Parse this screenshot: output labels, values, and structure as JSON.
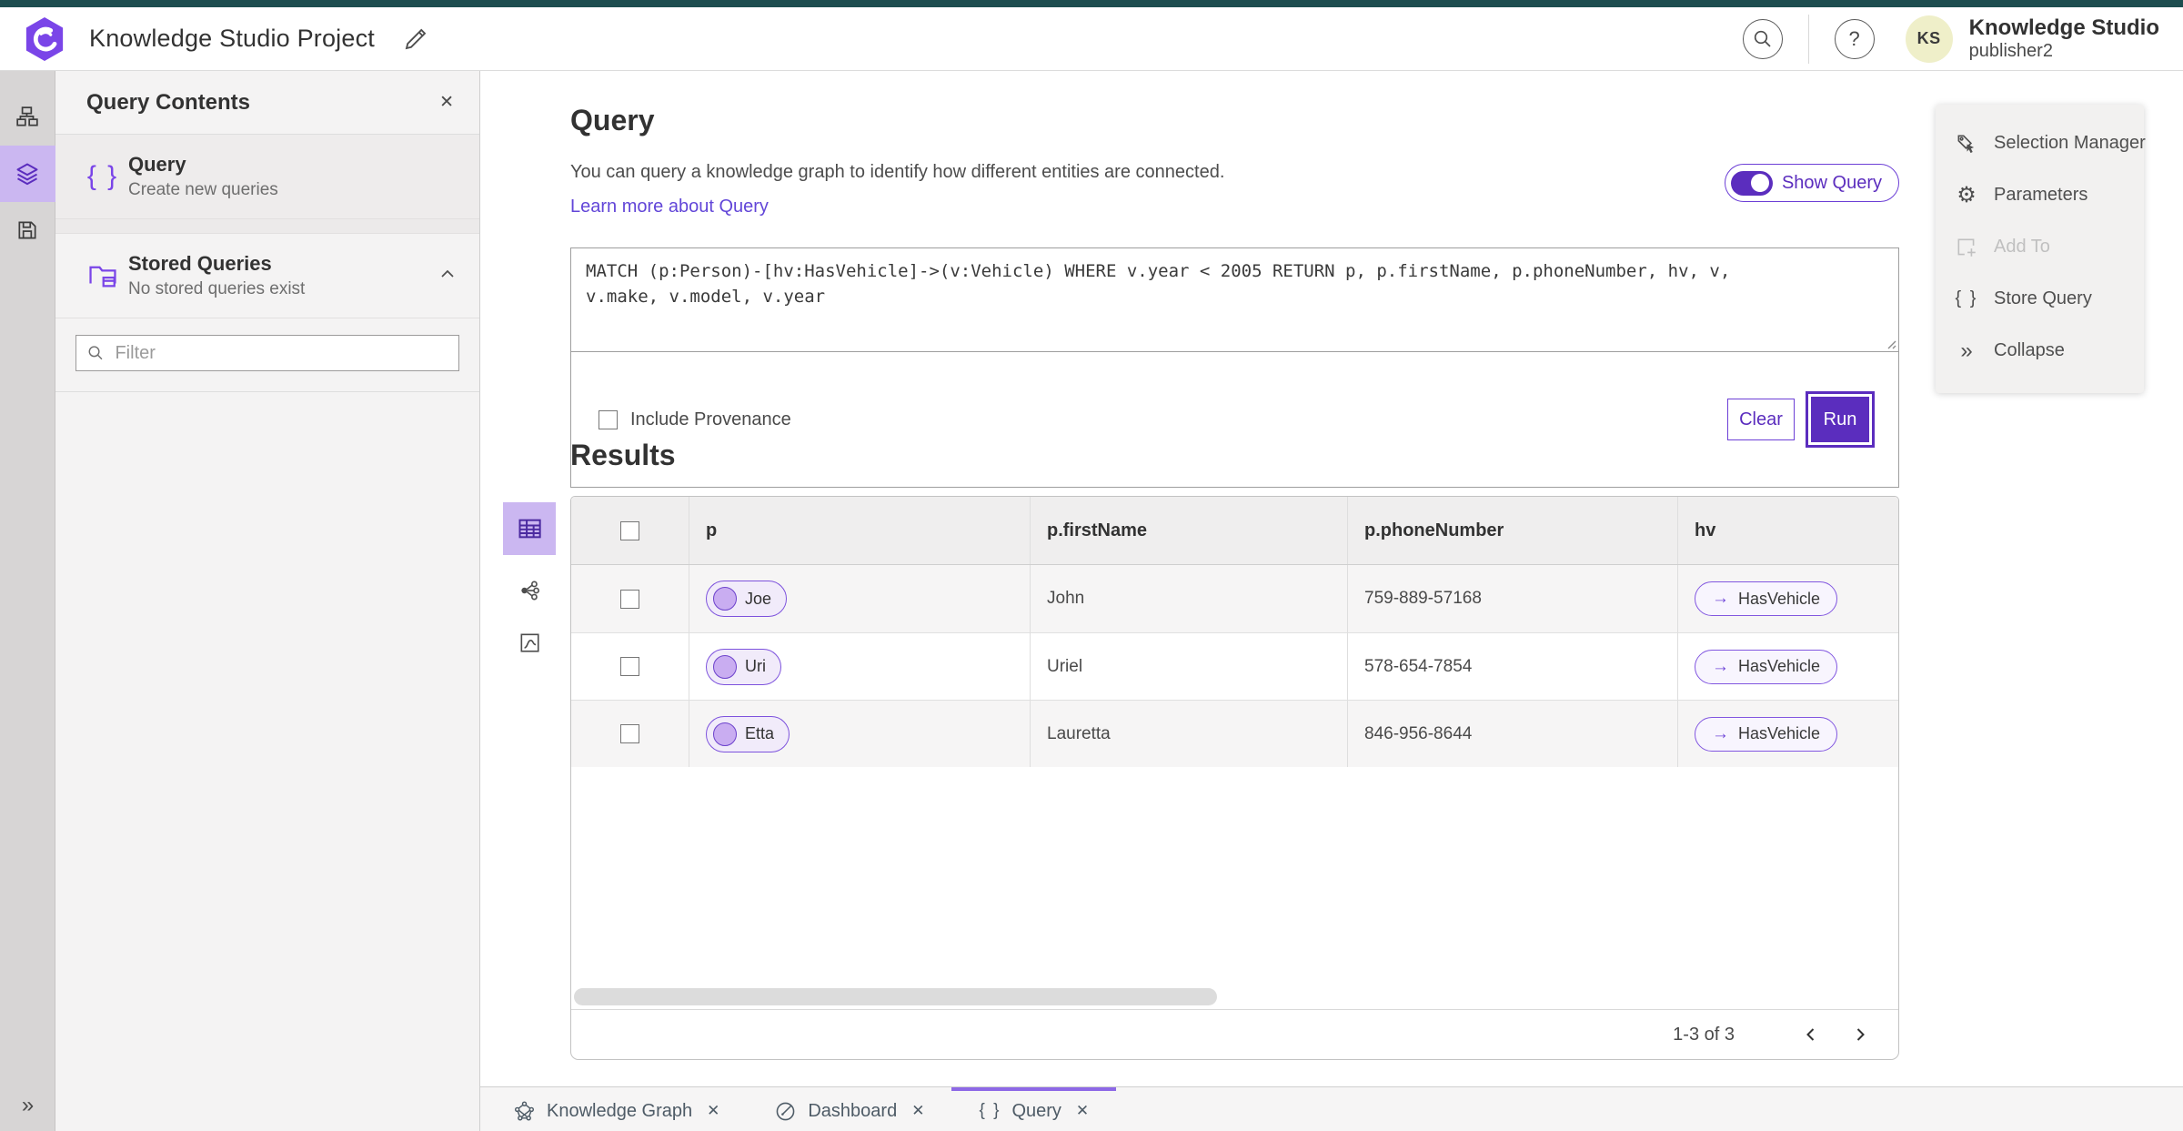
{
  "header": {
    "title": "Knowledge Studio Project",
    "account_title": "Knowledge Studio",
    "account_subtitle": "publisher2",
    "avatar_initials": "KS"
  },
  "panel": {
    "title": "Query Contents",
    "query_item": {
      "title": "Query",
      "subtitle": "Create new queries"
    },
    "stored_item": {
      "title": "Stored Queries",
      "subtitle": "No stored queries exist"
    },
    "filter_placeholder": "Filter"
  },
  "query_section": {
    "heading": "Query",
    "description": "You can query a knowledge graph to identify how different entities are connected.",
    "learn_more_label": "Learn more about Query",
    "show_query_label": "Show Query",
    "query_text": "MATCH (p:Person)-[hv:HasVehicle]->(v:Vehicle) WHERE v.year < 2005 RETURN p, p.firstName, p.phoneNumber, hv, v, v.make, v.model, v.year",
    "include_provenance_label": "Include Provenance",
    "clear_label": "Clear",
    "run_label": "Run"
  },
  "results": {
    "heading": "Results",
    "columns": [
      "p",
      "p.firstName",
      "p.phoneNumber",
      "hv"
    ],
    "rows": [
      {
        "p": "Joe",
        "firstName": "John",
        "phone": "759-889-57168",
        "hv": "HasVehicle"
      },
      {
        "p": "Uri",
        "firstName": "Uriel",
        "phone": "578-654-7854",
        "hv": "HasVehicle"
      },
      {
        "p": "Etta",
        "firstName": "Lauretta",
        "phone": "846-956-8644",
        "hv": "HasVehicle"
      }
    ],
    "pagination": "1-3 of 3"
  },
  "tools": {
    "items": [
      {
        "label": "Selection Manager"
      },
      {
        "label": "Parameters"
      },
      {
        "label": "Add To"
      },
      {
        "label": "Store Query"
      },
      {
        "label": "Collapse"
      }
    ]
  },
  "tabs": [
    {
      "label": "Knowledge Graph"
    },
    {
      "label": "Dashboard"
    },
    {
      "label": "Query"
    }
  ],
  "icons": {
    "close": "✕",
    "braces": "{ }",
    "gear": "⚙",
    "collapse_chevrons": "»",
    "expand_chevrons": "»",
    "edge_arrow": "→",
    "help": "?"
  },
  "colors": {
    "primary_purple": "#5b2dbe",
    "active_light_purple": "#cbb7f1",
    "teal_strip": "#1d4d4f",
    "avatar_bg": "#efefc9",
    "link_purple": "#6246d8",
    "tab_text": "#4e5b66"
  }
}
